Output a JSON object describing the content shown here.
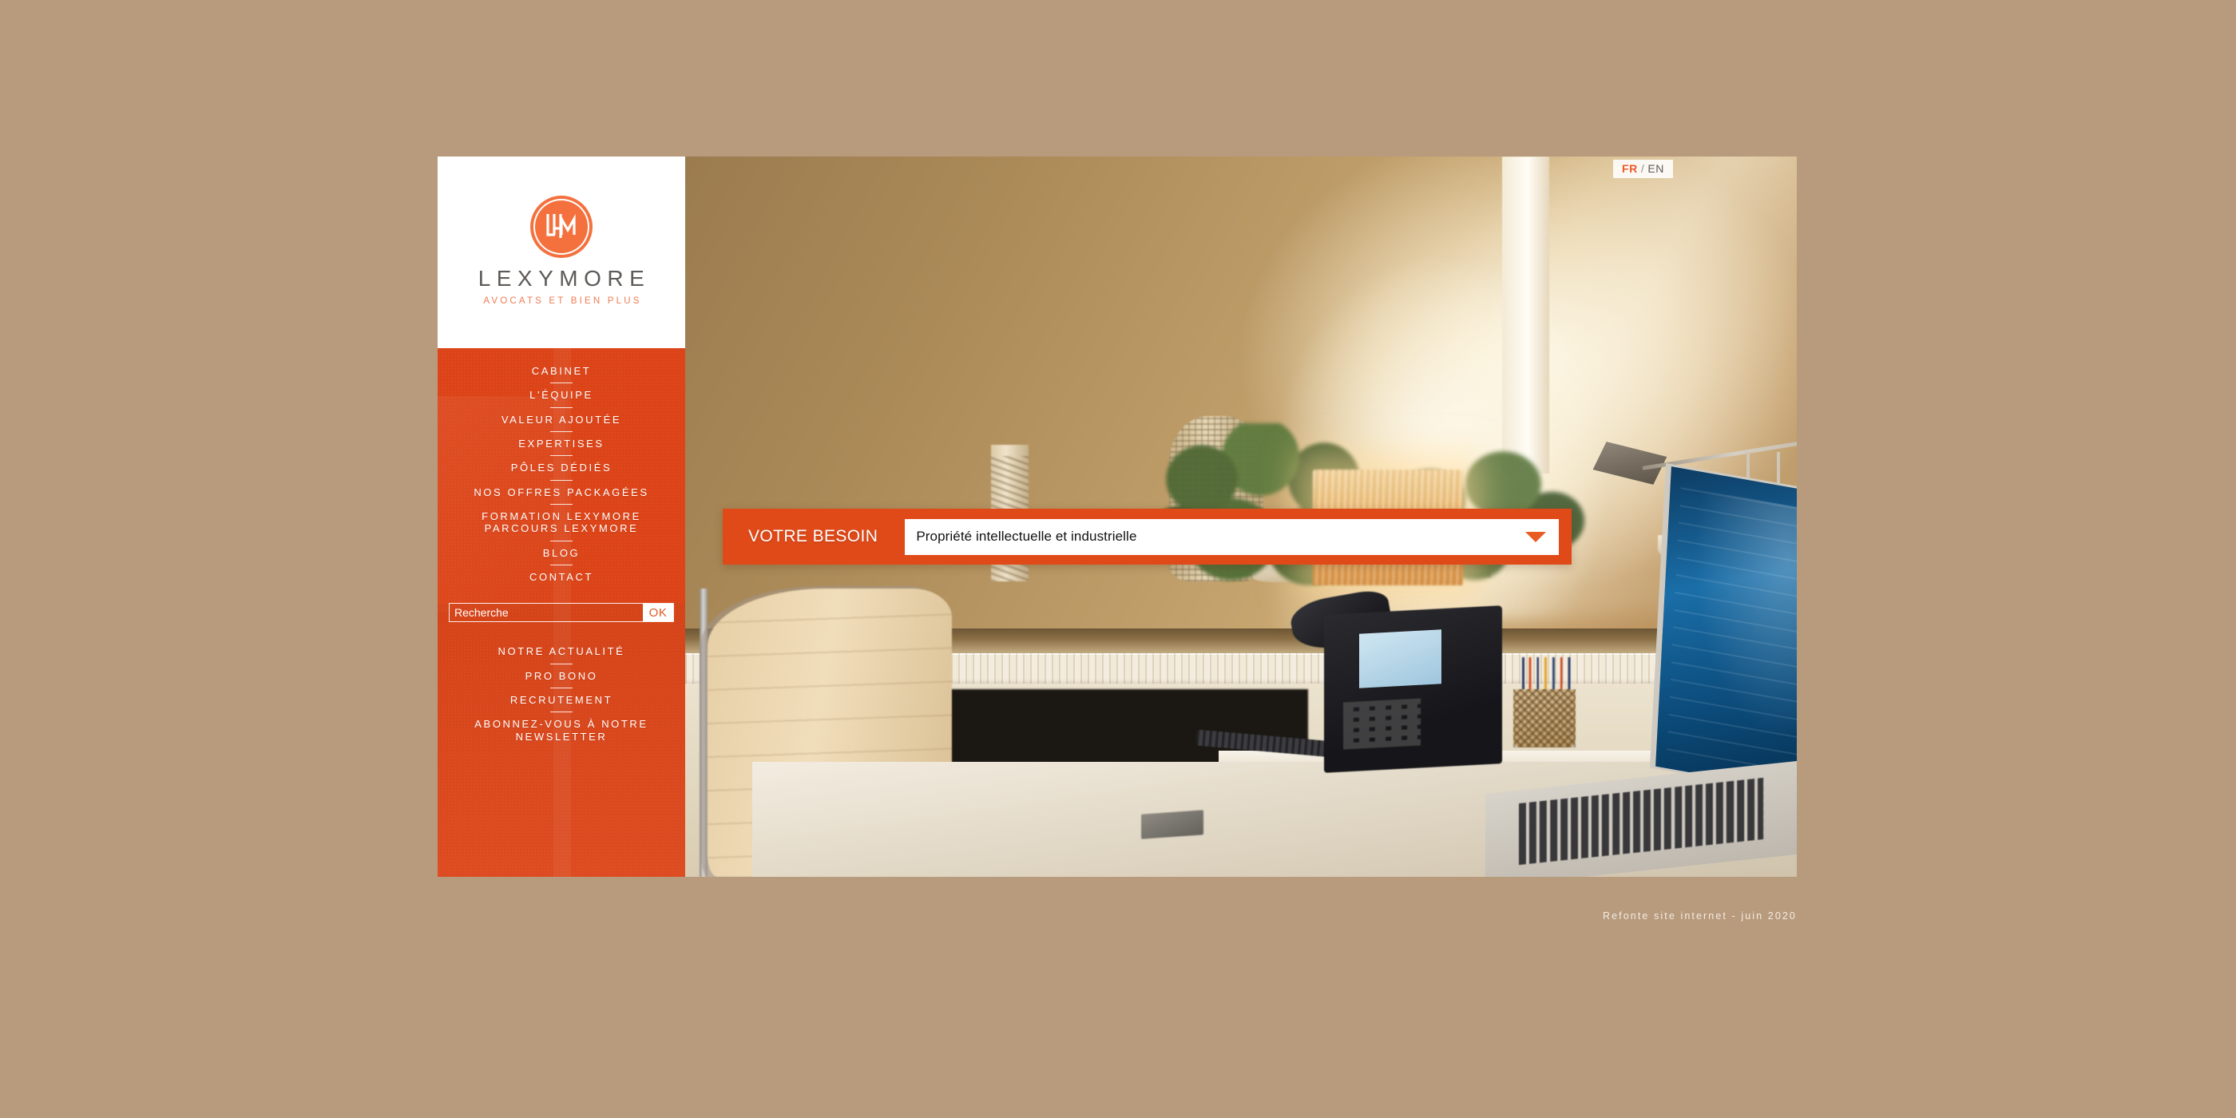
{
  "page": {
    "background_color": "#b89a7c",
    "brand_orange": "#dc4418",
    "accent_orange": "#e04a19",
    "logo_circle_color": "#f4713e"
  },
  "logo": {
    "monogram": "LLM",
    "wordmark": "LEXYMORE",
    "tagline": "AVOCATS ET BIEN PLUS"
  },
  "lang_switch": {
    "active": "FR",
    "separator": "/",
    "inactive": "EN"
  },
  "nav": {
    "primary": [
      {
        "label": "CABINET"
      },
      {
        "label": "L'ÉQUIPE"
      },
      {
        "label": "VALEUR AJOUTÉE"
      },
      {
        "label": "EXPERTISES"
      },
      {
        "label": "PÔLES DÉDIÉS"
      },
      {
        "label": "NOS OFFRES PACKAGÉES"
      },
      {
        "label": "FORMATION LEXYMORE PARCOURS LEXYMORE"
      },
      {
        "label": "BLOG"
      },
      {
        "label": "CONTACT"
      }
    ],
    "secondary": [
      {
        "label": "NOTRE ACTUALITÉ"
      },
      {
        "label": "PRO BONO"
      },
      {
        "label": "RECRUTEMENT"
      },
      {
        "label": "ABONNEZ-VOUS À NOTRE NEWSLETTER"
      }
    ]
  },
  "search": {
    "placeholder": "Recherche",
    "value": "",
    "submit_label": "OK"
  },
  "besoin": {
    "label": "VOTRE BESOIN",
    "selected": "Propriété intellectuelle et industrielle",
    "caret_icon": "chevron-down-icon"
  },
  "footer": {
    "credit": "Refonte site internet - juin 2020"
  }
}
